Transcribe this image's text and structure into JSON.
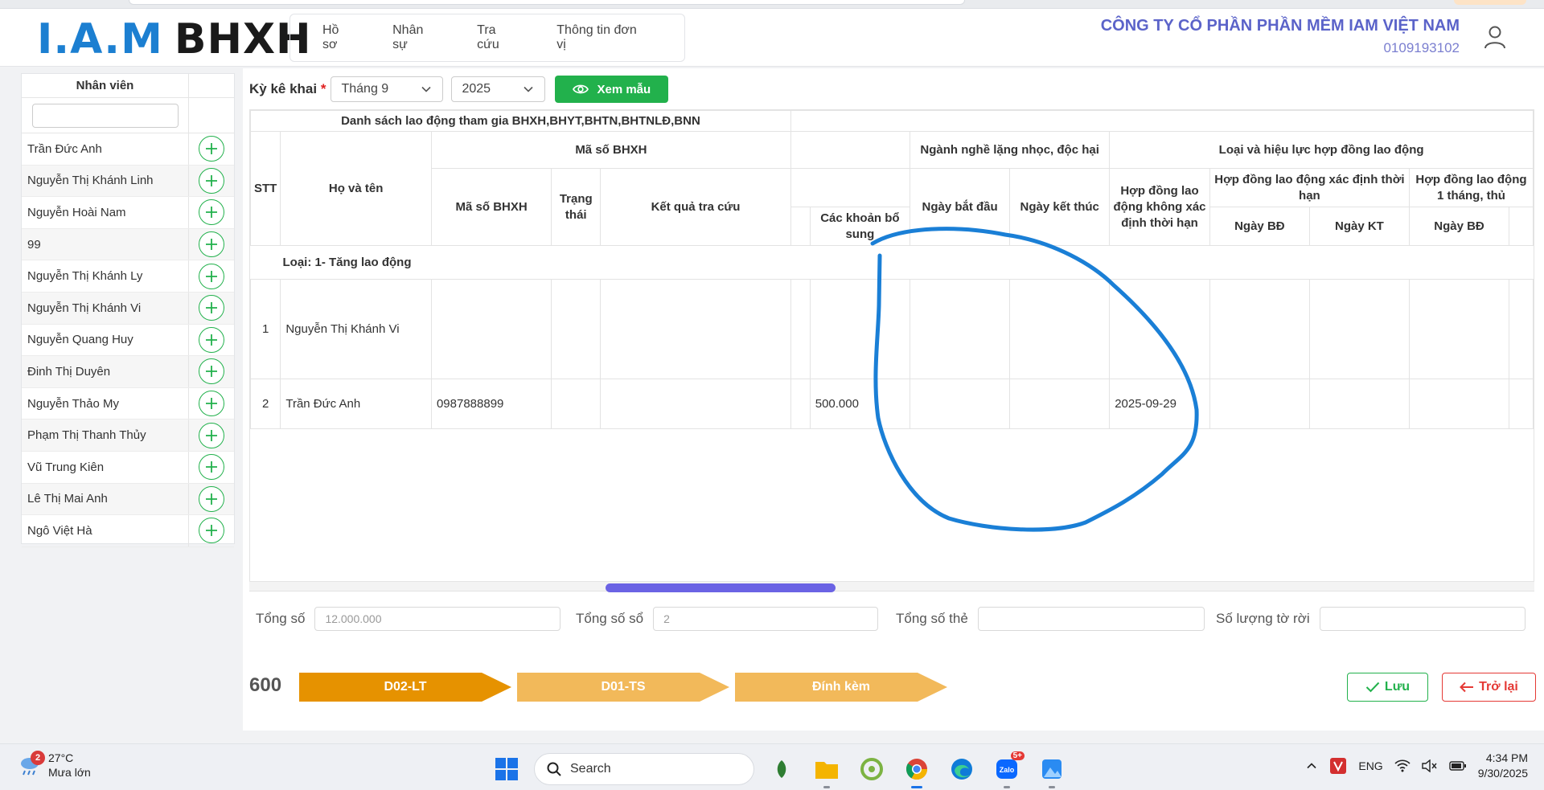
{
  "header": {
    "logo_part1": "I.A.M",
    "logo_part2": "BHXH",
    "nav": [
      "Hồ sơ",
      "Nhân sự",
      "Tra cứu",
      "Thông tin đơn vị"
    ],
    "company_name": "CÔNG TY CỔ PHẦN PHẦN MỀM IAM VIỆT NAM",
    "company_code": "0109193102"
  },
  "sidebar": {
    "title": "Nhân viên",
    "employees": [
      "Trần Đức Anh",
      "Nguyễn Thị Khánh Linh",
      "Nguyễn Hoài Nam",
      "99",
      "Nguyễn Thị Khánh Ly",
      "Nguyễn Thị Khánh Vi",
      "Nguyễn Quang Huy",
      "Đinh Thị Duyên",
      "Nguyễn Thảo My",
      "Phạm Thị Thanh Thủy",
      "Vũ Trung Kiên",
      "Lê Thị Mai Anh",
      "Ngô Việt Hà"
    ]
  },
  "filter": {
    "label": "Kỳ kê khai",
    "required_mark": "*",
    "month": "Tháng 9",
    "year": "2025",
    "view_button": "Xem mẫu"
  },
  "table": {
    "group_title": "Danh sách lao động tham gia BHXH,BHYT,BHTN,BHTNLĐ,BNN",
    "h_stt": "STT",
    "h_name": "Họ và tên",
    "h_ma_so": "Mã số BHXH",
    "h_ma_so_sub": "Mã số BHXH",
    "h_trang_thai": "Trạng thái",
    "h_ket_qua": "Kết quả tra cứu",
    "h_cac_khoan": "Các khoản bổ sung",
    "h_nganh_nghe": "Ngành nghề lặng nhọc, độc hại",
    "h_ngay_bat_dau": "Ngày bắt đầu",
    "h_ngay_ket_thuc": "Ngày kết thúc",
    "h_loai_hd": "Loại và hiệu lực hợp đồng lao động",
    "h_hd_khong_xd": "Hợp đồng lao động không xác định thời hạn",
    "h_hd_xd": "Hợp đồng lao động xác định thời hạn",
    "h_hd_1thang": "Hợp đồng lao động 1 tháng, thủ",
    "h_ngay_bd": "Ngày BĐ",
    "h_ngay_kt": "Ngày KT",
    "h_ngay_bd2": "Ngày BĐ",
    "group_row": "Loại: 1- Tăng lao động",
    "rows": [
      {
        "stt": "1",
        "name": "Nguyễn Thị Khánh Vi",
        "ma_so": "",
        "bo_sung": "",
        "hd_date": ""
      },
      {
        "stt": "2",
        "name": "Trần Đức Anh",
        "ma_so": "0987888899",
        "bo_sung": "500.000",
        "hd_date": "2025-09-29"
      }
    ]
  },
  "totals": {
    "tong_so_label": "Tổng số",
    "tong_so_value": "12.000.000",
    "tong_so_so_label": "Tổng số sổ",
    "tong_so_so_value": "2",
    "tong_so_the_label": "Tổng số thẻ",
    "tong_so_the_value": "",
    "so_luong_label": "Số lượng tờ rời",
    "so_luong_value": ""
  },
  "footer": {
    "code": "600",
    "steps": [
      "D02-LT",
      "D01-TS",
      "Đính kèm"
    ],
    "save": "Lưu",
    "back": "Trở lại"
  },
  "colors": {
    "green": "#22b14c",
    "step_active": "#e69200",
    "step_inactive": "#f2b95a",
    "brand_blue": "#1c7fd1",
    "company_purple": "#5b63c9",
    "danger": "#e53935",
    "scribble": "#1a7fd6"
  },
  "taskbar": {
    "weather_badge": "2",
    "temp": "27°C",
    "weather": "Mưa lớn",
    "search": "Search",
    "chat_badge": "5+",
    "lang": "ENG",
    "time": "4:34 PM",
    "date": "9/30/2025"
  }
}
